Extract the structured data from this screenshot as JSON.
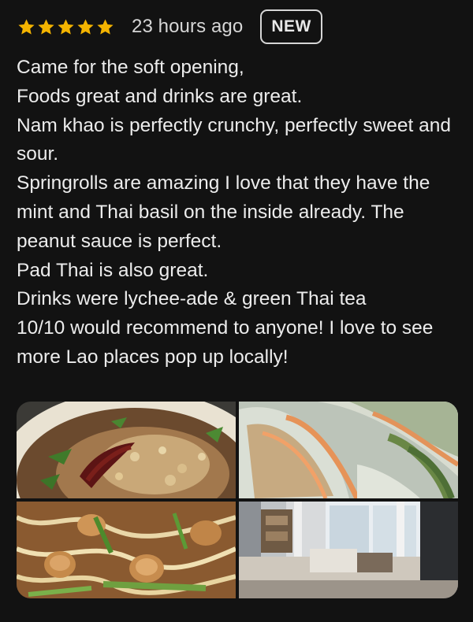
{
  "review": {
    "rating": 5,
    "max_rating": 5,
    "time": "23 hours ago",
    "badge": "NEW",
    "lines": [
      "Came for the soft opening,",
      "Foods great and drinks are great.",
      "Nam khao is perfectly crunchy, perfectly sweet and sour.",
      "Springrolls are amazing I love that they have the mint and Thai basil on the inside already. The peanut sauce is perfect.",
      "Pad Thai is also great.",
      "Drinks were lychee-ade & green Thai tea",
      "10/10 would recommend to anyone! I love to see more Lao places pop up locally!"
    ]
  },
  "colors": {
    "background": "#121212",
    "text": "#ececec",
    "star": "#f4b400"
  },
  "photos": [
    {
      "icon": "nam-khao-photo"
    },
    {
      "icon": "spring-rolls-photo"
    },
    {
      "icon": "pad-thai-photo"
    },
    {
      "icon": "restaurant-interior-photo"
    }
  ]
}
